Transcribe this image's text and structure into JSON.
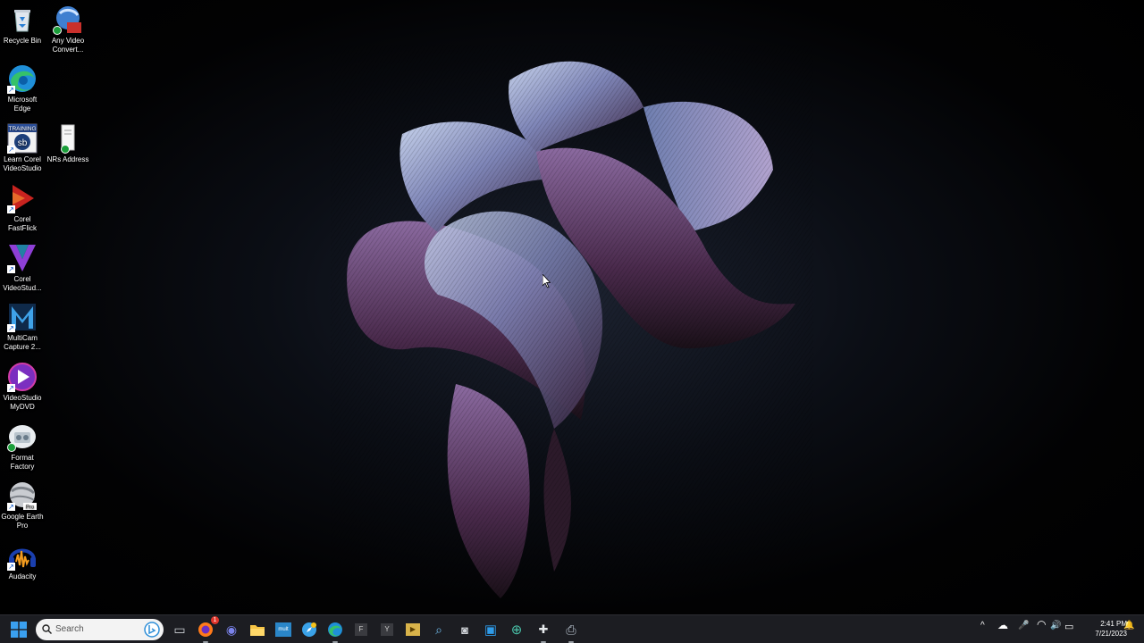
{
  "desktop_icons": [
    {
      "label": "Recycle Bin",
      "icon": "recycle-bin-icon"
    },
    {
      "label": "Any Video Convert...",
      "icon": "any-video-converter-icon"
    },
    {
      "label": "Microsoft Edge",
      "icon": "edge-icon"
    },
    {
      "label": "Learn Corel VideoStudio",
      "icon": "corel-training-icon"
    },
    {
      "label": "NRs Address",
      "icon": "document-icon"
    },
    {
      "label": "Corel FastFlick",
      "icon": "fastflick-icon"
    },
    {
      "label": "Corel VideoStud...",
      "icon": "videostudio-icon"
    },
    {
      "label": "MultiCam Capture 2...",
      "icon": "multicam-icon"
    },
    {
      "label": "VideoStudio MyDVD",
      "icon": "mydvd-icon"
    },
    {
      "label": "Format Factory",
      "icon": "format-factory-icon"
    },
    {
      "label": "Google Earth Pro",
      "icon": "google-earth-icon"
    },
    {
      "label": "Audacity",
      "icon": "audacity-icon"
    }
  ],
  "icon_text": {
    "training": "TRAINING",
    "training_logo": "sb",
    "google_earth_badge": "Pro",
    "shortcut_arrow": "↗"
  },
  "taskbar": {
    "search_placeholder": "Search",
    "notification_count": "1",
    "pinned": [
      {
        "name": "task-view",
        "icon": "task-view-icon",
        "glyph": "▭"
      },
      {
        "name": "firefox",
        "icon": "firefox-icon",
        "glyph": ""
      },
      {
        "name": "teams",
        "icon": "teams-icon",
        "glyph": "◉"
      },
      {
        "name": "file-explorer",
        "icon": "folder-icon",
        "glyph": ""
      },
      {
        "name": "multi-app",
        "icon": "multi-icon",
        "glyph": "mult"
      },
      {
        "name": "safari-like",
        "icon": "compass-icon",
        "glyph": ""
      },
      {
        "name": "edge",
        "icon": "edge-icon",
        "glyph": ""
      },
      {
        "name": "app-f",
        "icon": "app-f-icon",
        "glyph": "F"
      },
      {
        "name": "app-y",
        "icon": "app-y-icon",
        "glyph": "Y"
      },
      {
        "name": "media-app",
        "icon": "media-icon",
        "glyph": "▶"
      },
      {
        "name": "remote-app",
        "icon": "remote-icon",
        "glyph": "⌕"
      },
      {
        "name": "camera-app",
        "icon": "camera-icon",
        "glyph": "◙"
      },
      {
        "name": "store-app",
        "icon": "store-icon",
        "glyph": "▣"
      },
      {
        "name": "globe-app",
        "icon": "globe-icon",
        "glyph": "⊕"
      },
      {
        "name": "format-factory",
        "icon": "format-factory-icon",
        "glyph": "✚"
      },
      {
        "name": "printer-app",
        "icon": "printer-icon",
        "glyph": "⎙"
      }
    ],
    "tray": {
      "chevron": "^",
      "onedrive": "☁",
      "mic": "🎤",
      "wifi": "◠",
      "volume": "🔊",
      "battery": "▭",
      "notification": "🔔"
    },
    "time": "2:41 PM",
    "date": "7/21/2023"
  }
}
